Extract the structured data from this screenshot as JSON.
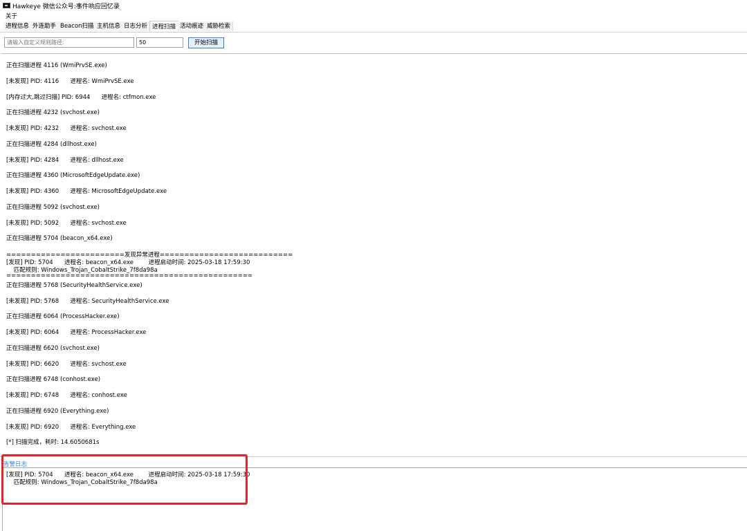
{
  "window": {
    "title": "Hawkeye 微信公众号:事件响应回忆录"
  },
  "menu": {
    "items": [
      "关于"
    ]
  },
  "tabs": [
    {
      "label": "进程信息"
    },
    {
      "label": "外连助手"
    },
    {
      "label": "Beacon扫描"
    },
    {
      "label": "主机信息"
    },
    {
      "label": "日志分析"
    },
    {
      "label": "进程扫描",
      "active": true
    },
    {
      "label": "活动痕迹"
    },
    {
      "label": "威胁检索"
    }
  ],
  "scan": {
    "path_placeholder": "请输入自定义规则路径:",
    "thread_value": "50",
    "start_label": "开始扫描"
  },
  "log": {
    "lines": [
      "正在扫描进程 4116 (WmiPrvSE.exe)",
      "[未发现] PID: 4116      进程名: WmiPrvSE.exe",
      "[内存过大,跳过扫描] PID: 6944      进程名: ctfmon.exe",
      "正在扫描进程 4232 (svchost.exe)",
      "[未发现] PID: 4232      进程名: svchost.exe",
      "正在扫描进程 4284 (dllhost.exe)",
      "[未发现] PID: 4284      进程名: dllhost.exe",
      "正在扫描进程 4360 (MicrosoftEdgeUpdate.exe)",
      "[未发现] PID: 4360      进程名: MicrosoftEdgeUpdate.exe",
      "正在扫描进程 5092 (svchost.exe)",
      "[未发现] PID: 5092      进程名: svchost.exe",
      "正在扫描进程 5704 (beacon_x64.exe)",
      "========================发现异常进程===========================",
      "[发现] PID: 5704      进程名: beacon_x64.exe        进程启动时间: 2025-03-18 17:59:30",
      "    匹配规则: Windows_Trojan_CobaltStrike_7f8da98a",
      "==================================================",
      "正在扫描进程 5768 (SecurityHealthService.exe)",
      "[未发现] PID: 5768      进程名: SecurityHealthService.exe",
      "正在扫描进程 6064 (ProcessHacker.exe)",
      "[未发现] PID: 6064      进程名: ProcessHacker.exe",
      "正在扫描进程 6620 (svchost.exe)",
      "[未发现] PID: 6620      进程名: svchost.exe",
      "正在扫描进程 6748 (conhost.exe)",
      "[未发现] PID: 6748      进程名: conhost.exe",
      "正在扫描进程 6920 (Everything.exe)",
      "[未发现] PID: 6920      进程名: Everything.exe",
      "[*] 扫描完成，耗时: 14.6050681s"
    ]
  },
  "alert": {
    "label": "告警日志",
    "lines": [
      "[发现] PID: 5704      进程名: beacon_x64.exe        进程启动时间: 2025-03-18 17:59:30",
      "    匹配规则: Windows_Trojan_CobaltStrike_7f8da98a"
    ]
  },
  "colors": {
    "highlight": "#e8222b",
    "alert_label": "#2f7fd0",
    "button_border": "#3c7fd1"
  }
}
